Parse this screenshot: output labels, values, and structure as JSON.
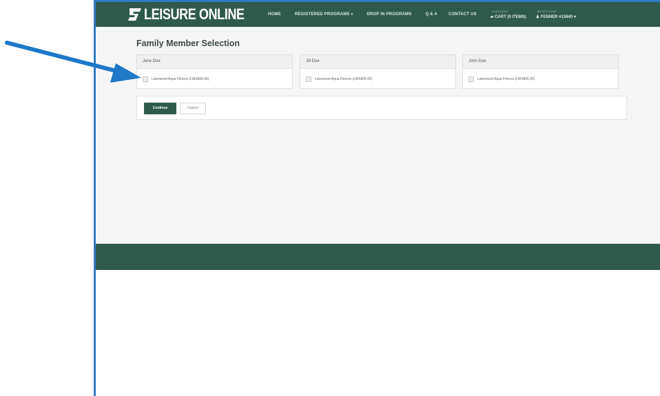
{
  "brand": {
    "logo_text": "LEISURE ONLINE"
  },
  "nav": {
    "home": "HOME",
    "registered_programs": "REGISTERED PROGRAMS",
    "drop_in_programs": "DROP IN PROGRAMS",
    "qa": "Q & A",
    "contact_us": "CONTACT US",
    "checkout_caption": "CHECKOUT",
    "cart": "CART (0 ITEMS)",
    "account_caption": "MY ACCOUNT",
    "account_name": "FENNER #13640",
    "caret_icon": "chevron-down-icon"
  },
  "page": {
    "title": "Family Member Selection"
  },
  "members": [
    {
      "name": "Jane Doe",
      "program": "Lakewood Aqua Fitness (LWS806.06)"
    },
    {
      "name": "Jill Doe",
      "program": "Lakewood Aqua Fitness (LWS806.06)"
    },
    {
      "name": "John Doe",
      "program": "Lakewood Aqua Fitness (LWS806.06)"
    }
  ],
  "actions": {
    "continue_label": "Continue",
    "cancel_label": "Cancel"
  },
  "colors": {
    "brand_green": "#2e5a4c",
    "annotation_arrow": "#1f78c8",
    "window_border": "#2f7bc4"
  }
}
